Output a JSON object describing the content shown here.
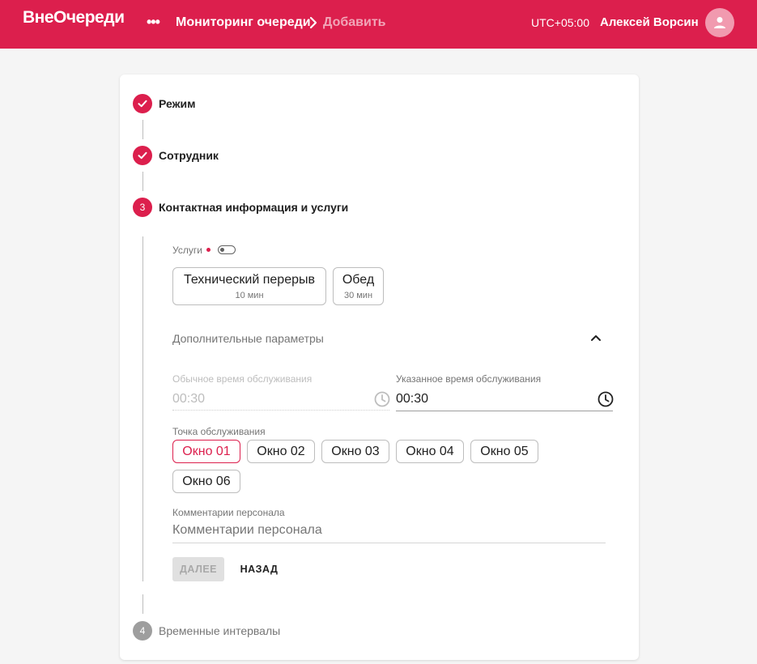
{
  "header": {
    "logo": "ВнеОчереди",
    "menu_glyph": "•••",
    "breadcrumb_current": "Мониторинг очереди",
    "breadcrumb_next": "Добавить",
    "timezone": "UTC+05:00",
    "user_name": "Алексей Ворсин",
    "avatar_icon": "person-icon"
  },
  "stepper": {
    "steps": [
      {
        "label": "Режим",
        "status": "done"
      },
      {
        "label": "Сотрудник",
        "status": "done"
      },
      {
        "number": "3",
        "label": "Контактная информация и услуги",
        "status": "active"
      },
      {
        "number": "4",
        "label": "Временные интервалы",
        "status": "pending"
      }
    ]
  },
  "form": {
    "services_label": "Услуги",
    "services": [
      {
        "name": "Технический перерыв",
        "duration": "10 мин"
      },
      {
        "name": "Обед",
        "duration": "30 мин"
      }
    ],
    "additional_params_label": "Дополнительные параметры",
    "usual_time": {
      "label": "Обычное время обслуживания",
      "value": "00:30"
    },
    "specified_time": {
      "label": "Указанное время обслуживания",
      "value": "00:30"
    },
    "service_point": {
      "label": "Точка обслуживания",
      "options": [
        "Окно 01",
        "Окно 02",
        "Окно 03",
        "Окно 04",
        "Окно 05",
        "Окно 06"
      ],
      "selected": "Окно 01"
    },
    "staff_comments": {
      "label": "Комментарии персонала",
      "placeholder": "Комментарии персонала"
    },
    "next_button": "ДАЛЕЕ",
    "back_button": "НАЗАД"
  },
  "colors": {
    "accent": "#dc1f4d",
    "header_bg": "#dc1f4d",
    "inactive": "#9e9e9e"
  }
}
